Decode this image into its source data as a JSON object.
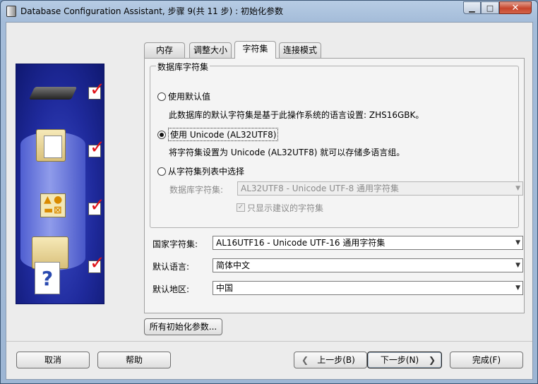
{
  "window": {
    "title": "Database Configuration Assistant, 步骤 9(共 11 步) : 初始化参数",
    "min_glyph": "▁",
    "max_glyph": "□",
    "close_glyph": "✕"
  },
  "tabs": [
    {
      "label": "内存"
    },
    {
      "label": "调整大小"
    },
    {
      "label": "字符集",
      "active": true
    },
    {
      "label": "连接模式"
    }
  ],
  "charset_group": {
    "legend": "数据库字符集",
    "default_option": "使用默认值",
    "default_desc": "此数据库的默认字符集是基于此操作系统的语言设置: ZHS16GBK。",
    "unicode_option": "使用 Unicode (AL32UTF8)",
    "unicode_desc": "将字符集设置为 Unicode (AL32UTF8) 就可以存储多语言组。",
    "list_option": "从字符集列表中选择",
    "db_charset_label": "数据库字符集:",
    "db_charset_value": "AL32UTF8 - Unicode UTF-8 通用字符集",
    "show_recommended": "只显示建议的字符集",
    "selected": "unicode"
  },
  "national_charset": {
    "label": "国家字符集:",
    "value": "AL16UTF16 - Unicode UTF-16 通用字符集"
  },
  "default_language": {
    "label": "默认语言:",
    "value": "简体中文"
  },
  "default_territory": {
    "label": "默认地区:",
    "value": "中国"
  },
  "buttons": {
    "all_params": "所有初始化参数...",
    "cancel": "取消",
    "help": "帮助",
    "back": "上一步(B)",
    "next": "下一步(N)",
    "finish": "完成(F)"
  }
}
